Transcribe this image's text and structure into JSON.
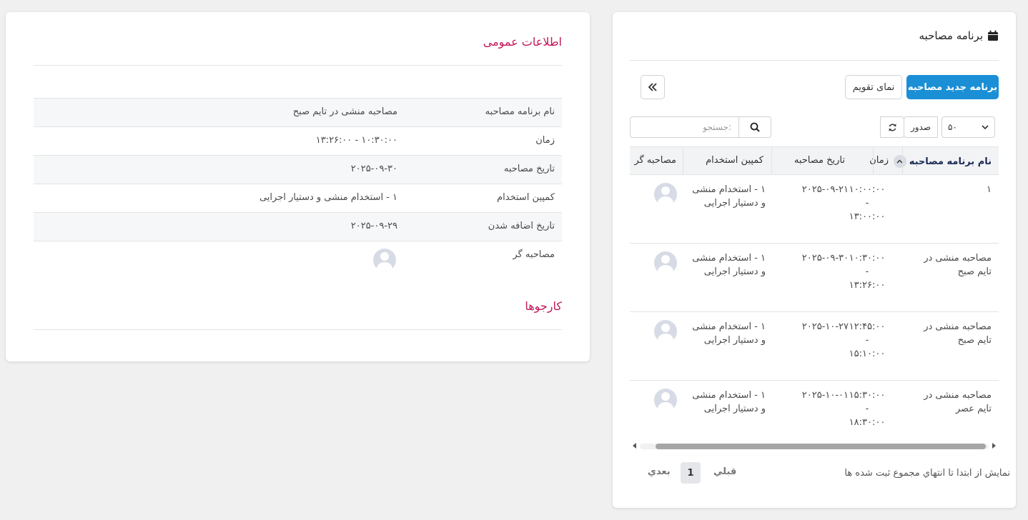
{
  "detail": {
    "general_title": "اطلاعات عمومی",
    "rows": [
      {
        "label": "نام برنامه مصاحبه",
        "value": "مصاحبه منشی در تایم صبح"
      },
      {
        "label": "زمان",
        "value": "۱۰:۳۰:۰۰ - ۱۳:۲۶:۰۰"
      },
      {
        "label": "تاریخ مصاحبه",
        "value": "۲۰۲۵-۰۹-۳۰"
      },
      {
        "label": "کمپین استخدام",
        "value": "۱ - استخدام منشی و دستیار اجرایی"
      },
      {
        "label": "تاریخ اضافه شدن",
        "value": "۲۰۲۵-۰۹-۲۹"
      },
      {
        "label": "مصاحبه گر",
        "value": ""
      }
    ],
    "applicants_title": "کارجوها"
  },
  "list": {
    "title": "برنامه مصاحبه",
    "new_button": "برنامه جدید مصاحبه",
    "calendar_button": "نمای تقویم",
    "page_size": "۵۰",
    "export_label": "صدور",
    "search_placeholder": "جستجو:",
    "columns": {
      "name": "نام برنامه مصاحبه",
      "time": "زمان",
      "date": "تاریخ مصاحبه",
      "campaign": "کمپین استخدام",
      "interviewer": "مصاحبه گر"
    },
    "rows": [
      {
        "name1": "۱",
        "name2": "",
        "t1": "۱۰:۰۰:۰۰",
        "t2": "-",
        "t3": "۱۳:۰۰:۰۰",
        "date": "۲۰۲۵-۰۹-۲۱",
        "c1": "۱ - استخدام منشی",
        "c2": "و دستیار اجرایی"
      },
      {
        "name1": "مصاحبه منشی در",
        "name2": "تایم صبح",
        "t1": "۱۰:۳۰:۰۰",
        "t2": "-",
        "t3": "۱۳:۲۶:۰۰",
        "date": "۲۰۲۵-۰۹-۳۰",
        "c1": "۱ - استخدام منشی",
        "c2": "و دستیار اجرایی"
      },
      {
        "name1": "مصاحبه منشی در",
        "name2": "تایم صبح",
        "t1": "۱۲:۴۵:۰۰",
        "t2": "-",
        "t3": "۱۵:۱۰:۰۰",
        "date": "۲۰۲۵-۱۰-۲۷",
        "c1": "۱ - استخدام منشی",
        "c2": "و دستیار اجرایی"
      },
      {
        "name1": "مصاحبه منشی در",
        "name2": "تایم عصر",
        "t1": "۱۵:۳۰:۰۰",
        "t2": "-",
        "t3": "۱۸:۳۰:۰۰",
        "date": "۲۰۲۵-۱۰-۰۱",
        "c1": "۱ - استخدام منشی",
        "c2": "و دستیار اجرایی"
      }
    ],
    "footer_info": "نمایش از ابتدا تا انتهاي مجموع ثبت شده ها",
    "prev": "قبلي",
    "page": "1",
    "next": "بعدي"
  }
}
